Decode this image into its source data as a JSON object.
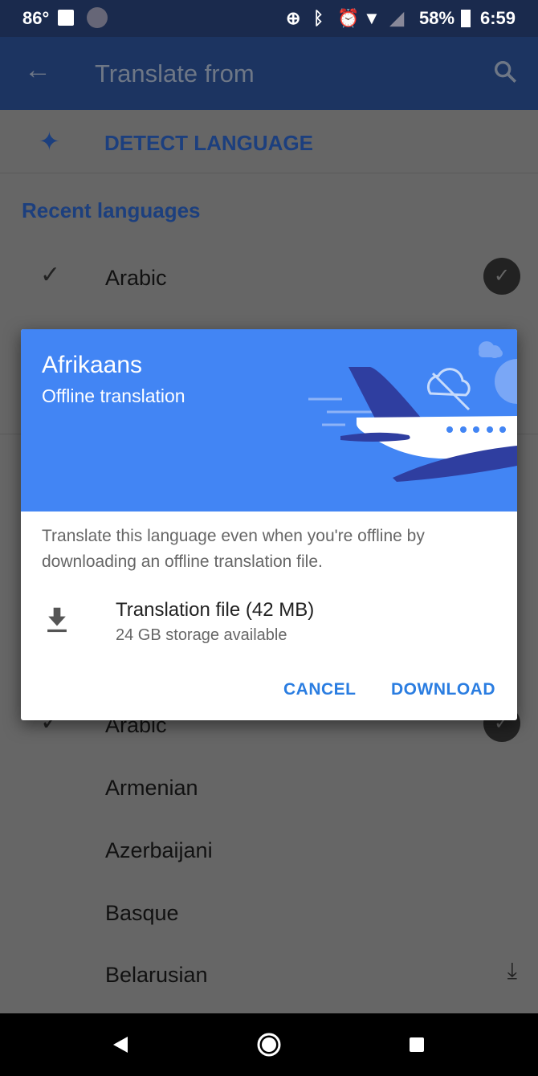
{
  "status_bar": {
    "temperature": "86°",
    "battery": "58%",
    "time": "6:59",
    "icons": [
      "image-icon",
      "shazam-icon",
      "data-saver-icon",
      "bluetooth-icon",
      "alarm-icon",
      "wifi-icon",
      "signal-icon",
      "battery-icon"
    ]
  },
  "app_bar": {
    "title": "Translate from",
    "back_icon": "arrow-back-icon",
    "search_icon": "search-icon"
  },
  "detect": {
    "label": "DETECT LANGUAGE",
    "icon": "sparkle-icon"
  },
  "recent": {
    "header": "Recent languages",
    "items": [
      {
        "name": "Arabic",
        "selected": true,
        "downloaded": true
      }
    ]
  },
  "all": {
    "items": [
      {
        "name": "Arabic",
        "selected": true,
        "downloaded": true
      },
      {
        "name": "Armenian"
      },
      {
        "name": "Azerbaijani"
      },
      {
        "name": "Basque"
      },
      {
        "name": "Belarusian",
        "downloadable": true
      }
    ]
  },
  "dialog": {
    "title": "Afrikaans",
    "subtitle": "Offline translation",
    "description": "Translate this language even when you're offline by downloading an offline translation file.",
    "file_label": "Translation file (42 MB)",
    "storage": "24 GB storage available",
    "cancel": "CANCEL",
    "download": "DOWNLOAD"
  },
  "colors": {
    "accent": "#4285f4",
    "button": "#2a7de1",
    "plane_dark": "#2f3ea0"
  }
}
